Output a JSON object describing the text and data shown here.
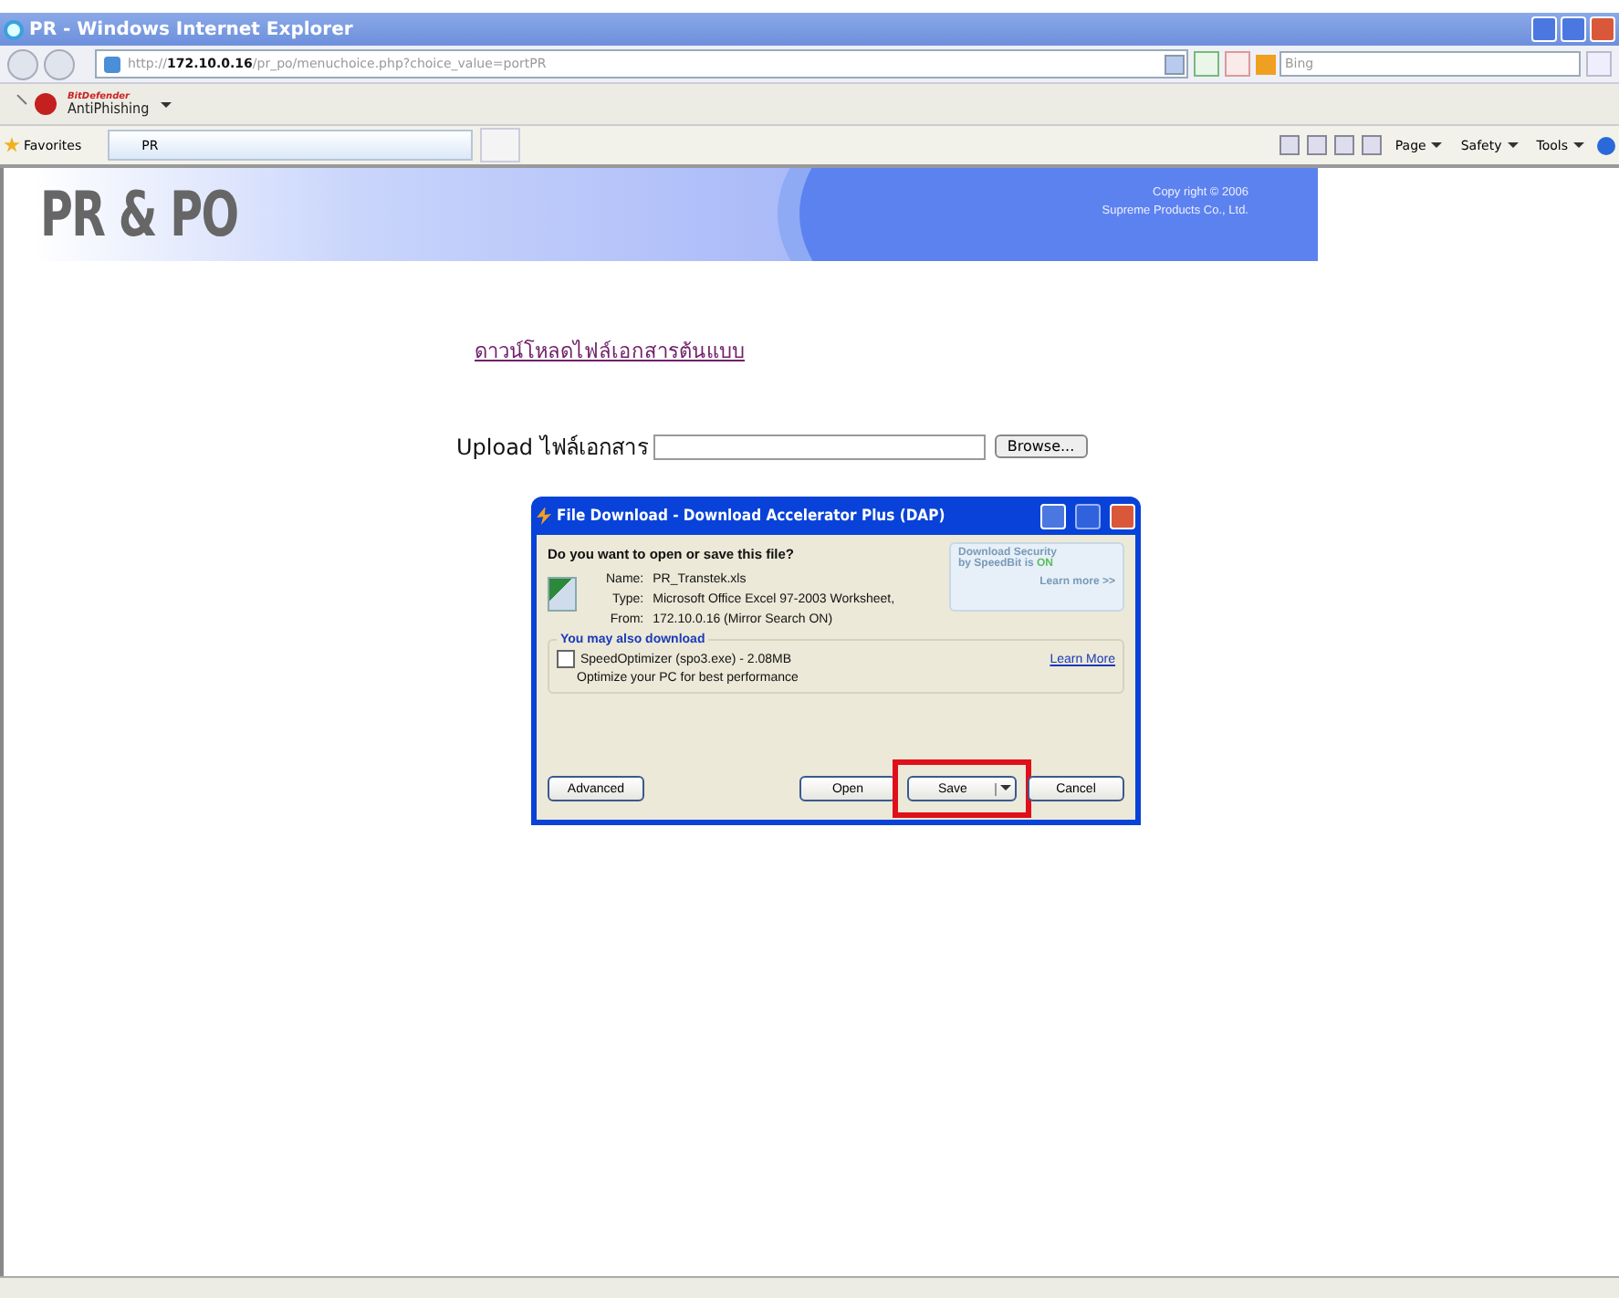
{
  "window": {
    "title": "PR - Windows Internet Explorer"
  },
  "address_bar": {
    "url": "http://**172.10.0.16**/pr_po/menuchoice.php?choice_value=portPR"
  },
  "search": {
    "placeholder": "Bing"
  },
  "addon_bar": {
    "brand": "BitDefender",
    "label": "AntiPhishing"
  },
  "favorites_bar": {
    "favorites": "Favorites",
    "tabs": [
      {
        "title": "PR",
        "selected": true
      }
    ],
    "commands": [
      "Page",
      "Safety",
      "Tools"
    ]
  },
  "page": {
    "logo": "PR & PO",
    "copyright": [
      "Copy right © 2006",
      "Supreme Products Co., Ltd."
    ],
    "download_link": "ดาวน์โหลดไฟล์เอกสารต้นแบบ",
    "upload": {
      "label": "Upload ไฟล์เอกสาร",
      "button": "Browse..."
    }
  },
  "dialog": {
    "title": "File Download - Download Accelerator Plus (DAP)",
    "question": "Do you want to open or save this file?",
    "fields": [
      {
        "label": "Name:",
        "value": "PR_Transtek.xls"
      },
      {
        "label": "Type:",
        "value": "Microsoft Office Excel 97-2003 Worksheet,"
      },
      {
        "label": "From:",
        "value": "172.10.0.16 (Mirror Search ON)"
      }
    ],
    "security": {
      "title": "Download Security",
      "status": "by SpeedBit is **ON**",
      "link": "Learn more >>"
    },
    "offer": {
      "heading": "You may also download",
      "item": "SpeedOptimizer (spo3.exe) - 2.08MB",
      "checked": false,
      "description": "Optimize your PC for best performance",
      "link": "Learn More"
    },
    "buttons": [
      {
        "label": "Advanced",
        "kind": "plain",
        "highlighted": false
      },
      {
        "label": "Open",
        "kind": "plain",
        "highlighted": false
      },
      {
        "label": "Save",
        "kind": "split",
        "highlighted": true
      },
      {
        "label": "Cancel",
        "kind": "plain",
        "highlighted": false
      }
    ]
  }
}
